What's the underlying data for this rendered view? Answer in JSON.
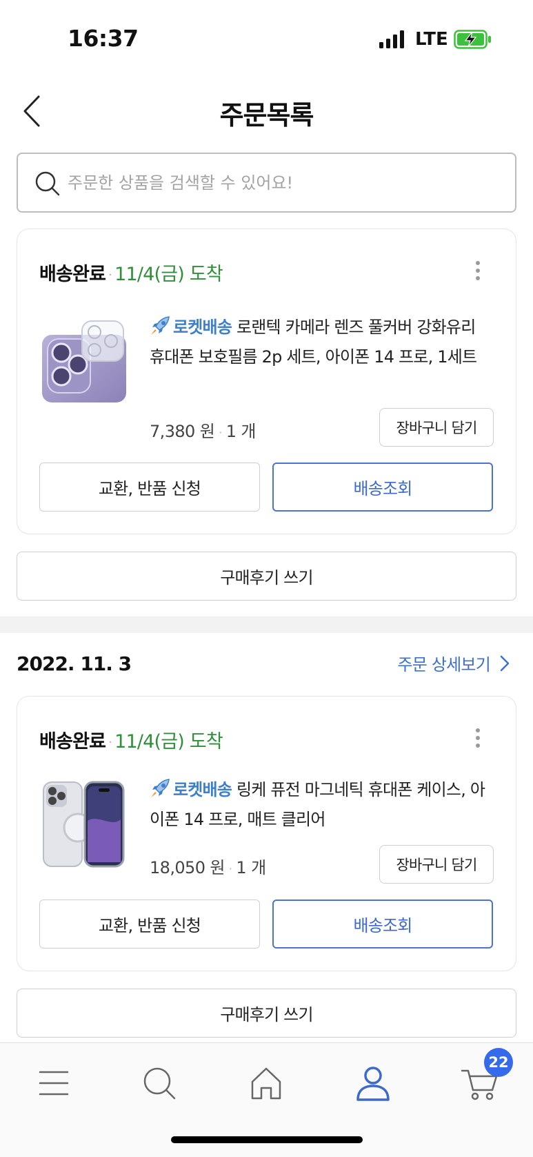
{
  "status_bar": {
    "time": "16:37",
    "network": "LTE"
  },
  "header": {
    "title": "주문목록"
  },
  "search": {
    "placeholder": "주문한 상품을 검색할 수 있어요!"
  },
  "orders": [
    {
      "date": "",
      "status": "배송완료",
      "arrival": "11/4(금) 도착",
      "rocket_label": "로켓배송",
      "product_name": "로랜텍 카메라 렌즈 풀커버 강화유리 휴대폰 보호필름 2p 세트, 아이폰 14 프로, 1세트",
      "price": "7,380 원",
      "quantity": "1 개",
      "cart_button": "장바구니 담기",
      "return_button": "교환, 반품 신청",
      "track_button": "배송조회",
      "review_button": "구매후기 쓰기"
    },
    {
      "date": "2022. 11. 3",
      "detail_link": "주문 상세보기",
      "status": "배송완료",
      "arrival": "11/4(금) 도착",
      "rocket_label": "로켓배송",
      "product_name": "링케 퓨전 마그네틱 휴대폰 케이스, 아이폰 14 프로, 매트 클리어",
      "price": "18,050 원",
      "quantity": "1 개",
      "cart_button": "장바구니 담기",
      "return_button": "교환, 반품 신청",
      "track_button": "배송조회",
      "review_button": "구매후기 쓰기"
    }
  ],
  "tabbar": {
    "items": [
      "menu-icon",
      "search-icon",
      "home-icon",
      "profile-icon",
      "cart-icon"
    ],
    "active": "profile-icon",
    "cart_count": "22"
  },
  "colors": {
    "accent_blue": "#3c68cf",
    "arrival_green": "#2f8f3a",
    "rocket_blue": "#3d80c9",
    "badge_blue": "#346aeb"
  }
}
